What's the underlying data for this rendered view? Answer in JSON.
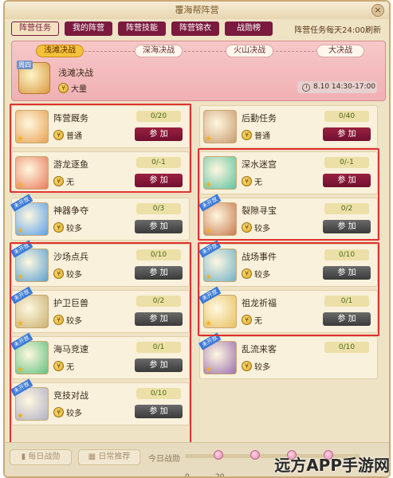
{
  "window": {
    "title": "覆海帮阵营",
    "close": "×"
  },
  "tabs": [
    "阵营任务",
    "我的阵营",
    "阵营技能",
    "阵营锦衣",
    "战勋榜"
  ],
  "notice": "阵营任务每天24:00刷新",
  "banner": {
    "stages": [
      "浅滩决战",
      "深海决战",
      "火山决战",
      "大决战"
    ],
    "current_stage": 0,
    "name": "浅滩决战",
    "label": "周四",
    "reward": "大量",
    "time": "8.10 14:30-17:00"
  },
  "tasks": [
    {
      "name": "阵营厩务",
      "count": "0/20",
      "reward": "普通",
      "button": "参 加",
      "button_style": "red",
      "icon": "shield-icon",
      "ribbon": ""
    },
    {
      "name": "后勤任务",
      "count": "0/40",
      "reward": "普通",
      "button": "参 加",
      "button_style": "red",
      "icon": "cart-icon",
      "ribbon": ""
    },
    {
      "name": "游龙逐鱼",
      "count": "0/-1",
      "reward": "无",
      "button": "参 加",
      "button_style": "red",
      "icon": "fish-icon",
      "ribbon": ""
    },
    {
      "name": "深水迷宫",
      "count": "0/-1",
      "reward": "无",
      "button": "参 加",
      "button_style": "red",
      "icon": "jelly-icon",
      "ribbon": ""
    },
    {
      "name": "神器争夺",
      "count": "0/3",
      "reward": "较多",
      "button": "参 加",
      "button_style": "gray",
      "icon": "orb-icon",
      "ribbon": "未开放"
    },
    {
      "name": "裂隙寻宝",
      "count": "0/2",
      "reward": "较多",
      "button": "参 加",
      "button_style": "gray",
      "icon": "chest-icon",
      "ribbon": "未开放"
    },
    {
      "name": "沙场点兵",
      "count": "0/10",
      "reward": "较多",
      "button": "参 加",
      "button_style": "gray",
      "icon": "flag-icon",
      "ribbon": "未开放"
    },
    {
      "name": "战场事件",
      "count": "0/10",
      "reward": "较多",
      "button": "参 加",
      "button_style": "gray",
      "icon": "battle-icon",
      "ribbon": "未开放"
    },
    {
      "name": "护卫巨兽",
      "count": "0/2",
      "reward": "较多",
      "button": "参 加",
      "button_style": "gray",
      "icon": "beast-icon",
      "ribbon": "未开放"
    },
    {
      "name": "祖龙祈福",
      "count": "0/1",
      "reward": "无",
      "button": "参 加",
      "button_style": "gray",
      "icon": "dragon-icon",
      "ribbon": "未开放"
    },
    {
      "name": "海马竞速",
      "count": "0/1",
      "reward": "无",
      "button": "参 加",
      "button_style": "gray",
      "icon": "seahorse-icon",
      "ribbon": "未开放"
    },
    {
      "name": "乱流来客",
      "count": "0/10",
      "reward": "较多",
      "button": "",
      "button_style": "none",
      "icon": "creature-icon",
      "ribbon": "未开放"
    },
    {
      "name": "竞技对战",
      "count": "0/10",
      "reward": "较多",
      "button": "参 加",
      "button_style": "gray",
      "icon": "swords-icon",
      "ribbon": "未开放"
    }
  ],
  "bottom": {
    "daily_battle": "每日战勋",
    "daily_recommend": "日常推荐",
    "progress_label": "今日战勋",
    "progress_value": 0,
    "milestones": [
      "0",
      "20"
    ]
  },
  "watermark": "远方APP手游网",
  "colors": {
    "accent": "#7a1a3e",
    "highlight_box": "#e03030",
    "disabled_button": "#3a3a3a"
  }
}
